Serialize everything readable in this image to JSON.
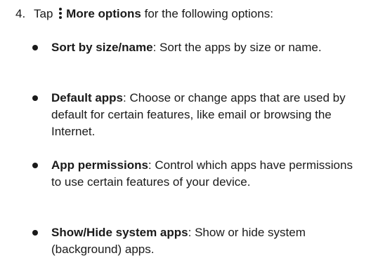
{
  "step": {
    "number": "4.",
    "prefix": "Tap",
    "icon": "more-options-vertical-dots-icon",
    "action": "More options",
    "suffix": "for the following options:"
  },
  "options": [
    {
      "title": "Sort by size/name",
      "description": ": Sort the apps by size or name."
    },
    {
      "title": "Default apps",
      "description": ": Choose or change apps that are used by default for certain features, like email or browsing the Internet."
    },
    {
      "title": "App permissions",
      "description": ": Control which apps have permissions to use certain features of your device."
    },
    {
      "title": "Show/Hide system apps",
      "description": ": Show or hide system (background) apps."
    }
  ]
}
